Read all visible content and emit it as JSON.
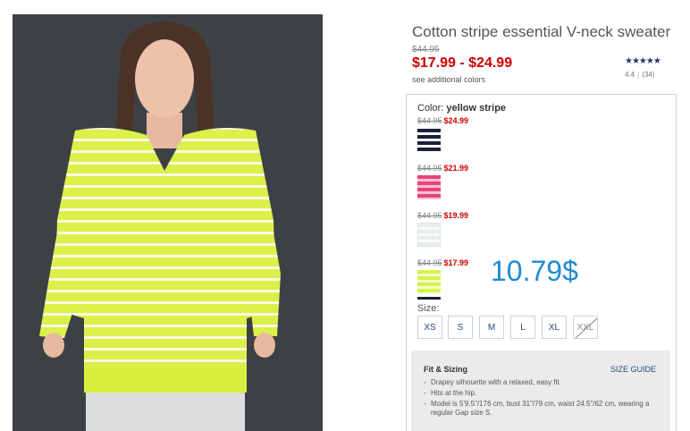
{
  "product": {
    "title": "Cotton stripe essential V-neck sweater",
    "original_price": "$44.95",
    "sale_price": "$17.99 - $24.99",
    "more_colors_link": "see additional colors",
    "stars": "★★★★★",
    "rating": "4.4",
    "review_count": "(34)"
  },
  "color": {
    "label": "Color:",
    "selected": "yellow stripe",
    "swatches": [
      {
        "old_price": "$44.95",
        "new_price": "$24.99",
        "name": "navy stripe",
        "hex": "#1b2139"
      },
      {
        "old_price": "$44.95",
        "new_price": "$21.99",
        "name": "pink stripe",
        "hex": "#e8447a"
      },
      {
        "old_price": "$44.95",
        "new_price": "$19.99",
        "name": "white stripe",
        "hex": "#e6efea"
      },
      {
        "old_price": "$44.95",
        "new_price": "$17.99",
        "name": "yellow stripe",
        "hex": "#d9f24a"
      }
    ]
  },
  "overlay_price": "10.79$",
  "size": {
    "label": "Size:",
    "options": [
      "XS",
      "S",
      "M",
      "L",
      "XL",
      "XXL"
    ],
    "unavailable": [
      "XXL"
    ]
  },
  "fit": {
    "title": "Fit & Sizing",
    "size_guide": "SIZE GUIDE",
    "bullets": [
      "Drapey silhouette with a relaxed, easy fit.",
      "Hits at the hip.",
      "Model is 5'9.5\"/176 cm, bust 31\"/79 cm, waist 24.5\"/62 cm, wearing a regular Gap size S."
    ]
  },
  "colors": {
    "accent_red": "#cc0000",
    "link_blue": "#2a4a7a",
    "overlay_blue": "#1f8ad6"
  }
}
